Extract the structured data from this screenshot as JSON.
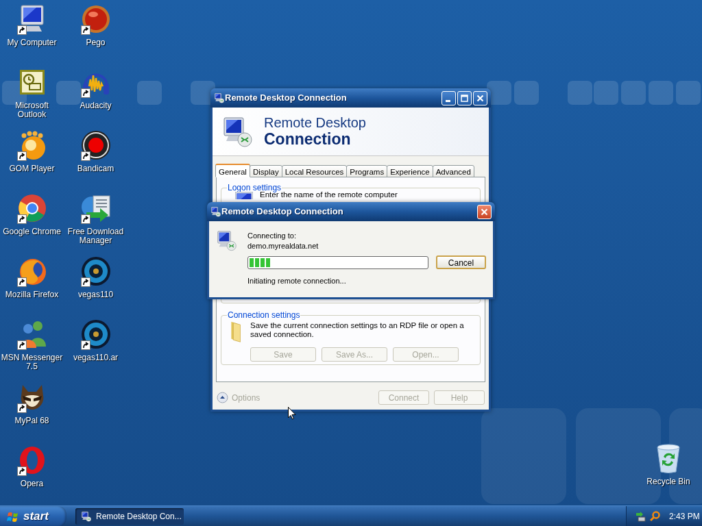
{
  "desktop": {
    "icons": [
      {
        "label": "My Computer",
        "shortcut": true
      },
      {
        "label": "Microsoft Outlook",
        "shortcut": false
      },
      {
        "label": "GOM Player",
        "shortcut": true
      },
      {
        "label": "Google Chrome",
        "shortcut": true
      },
      {
        "label": "Mozilla Firefox",
        "shortcut": true
      },
      {
        "label": "MSN Messenger 7.5",
        "shortcut": true
      },
      {
        "label": "MyPal 68",
        "shortcut": true
      },
      {
        "label": "Opera",
        "shortcut": true
      },
      {
        "label": "Pego",
        "shortcut": true
      },
      {
        "label": "Audacity",
        "shortcut": true
      },
      {
        "label": "Bandicam",
        "shortcut": true
      },
      {
        "label": "Free Download Manager",
        "shortcut": true
      },
      {
        "label": "vegas110",
        "shortcut": true
      },
      {
        "label": "vegas110.ar",
        "shortcut": true
      }
    ],
    "recycle_bin": {
      "label": "Recycle Bin"
    }
  },
  "main_window": {
    "title": "Remote Desktop Connection",
    "banner": {
      "line1": "Remote Desktop",
      "line2": "Connection"
    },
    "tabs": [
      {
        "label": "General",
        "selected": true
      },
      {
        "label": "Display",
        "selected": false
      },
      {
        "label": "Local Resources",
        "selected": false
      },
      {
        "label": "Programs",
        "selected": false
      },
      {
        "label": "Experience",
        "selected": false
      },
      {
        "label": "Advanced",
        "selected": false
      }
    ],
    "logon_settings": {
      "title": "Logon settings",
      "text": "Enter the name of the remote computer"
    },
    "connection_settings": {
      "title": "Connection settings",
      "text": "Save the current connection settings to an RDP file or open a saved connection.",
      "buttons": [
        {
          "label": "Save",
          "disabled": true
        },
        {
          "label": "Save As...",
          "disabled": true
        },
        {
          "label": "Open...",
          "disabled": true
        }
      ]
    },
    "options": {
      "label": "Options",
      "disabled": true
    },
    "buttons": [
      {
        "label": "Connect",
        "disabled": true
      },
      {
        "label": "Help",
        "disabled": true
      }
    ]
  },
  "dialog": {
    "title": "Remote Desktop Connection",
    "connecting_label": "Connecting to:",
    "host": "demo.myrealdata.net",
    "progress": {
      "level": 0.12
    },
    "cancel_button": "Cancel",
    "status": "Initiating remote connection..."
  },
  "taskbar": {
    "start": "start",
    "tasks": [
      {
        "label": "Remote Desktop Con...",
        "selected": true
      }
    ],
    "clock": "2:43 PM"
  }
}
